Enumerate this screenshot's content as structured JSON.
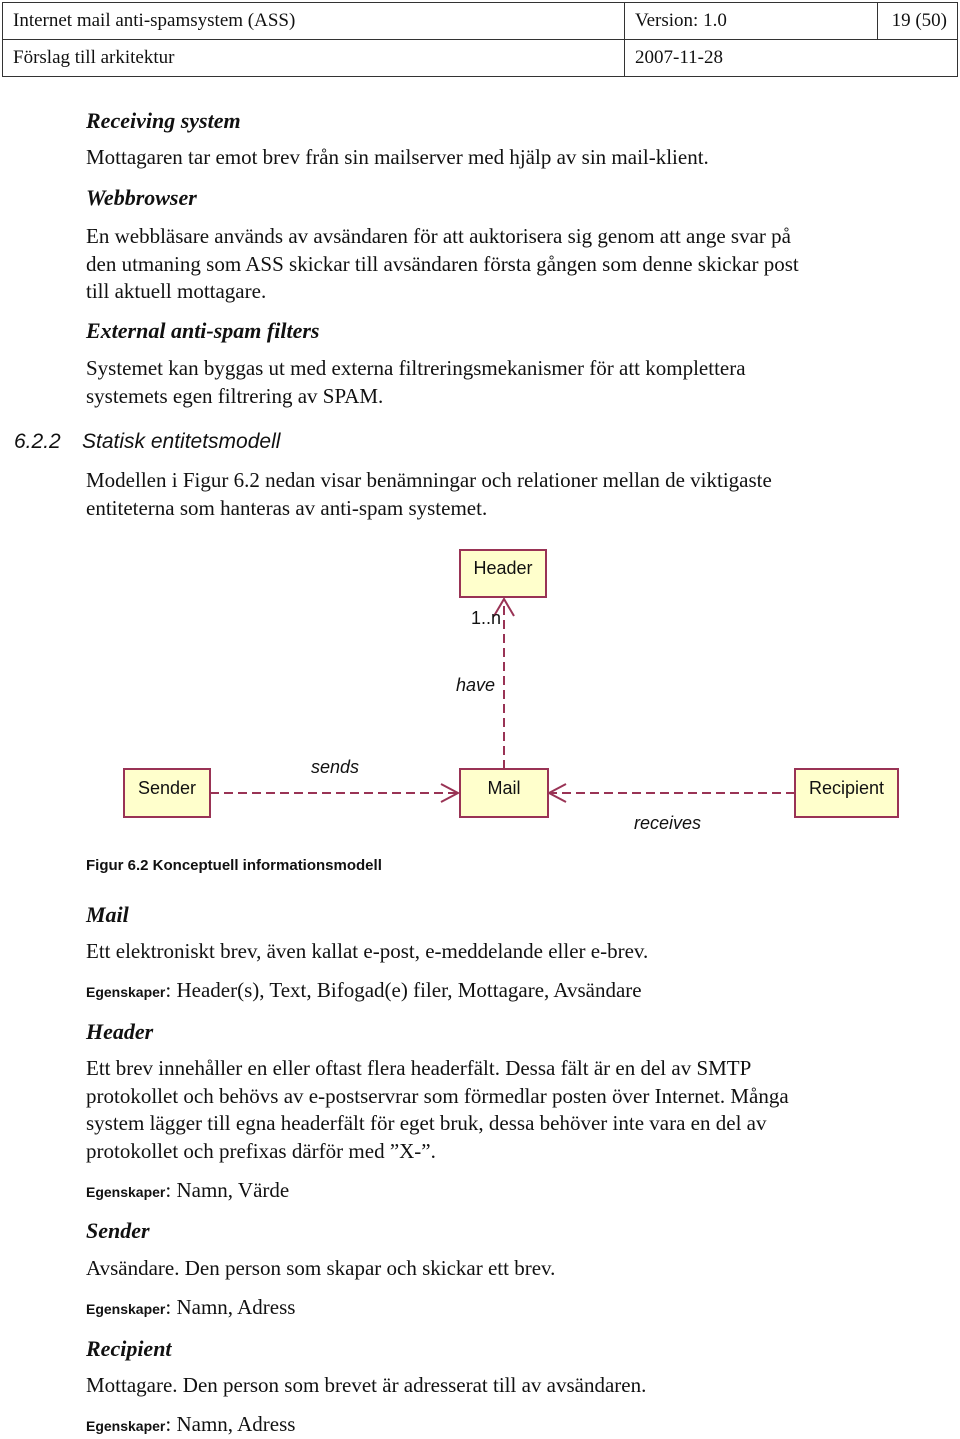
{
  "header": {
    "doc_title": "Internet mail anti-spamsystem (ASS)",
    "version": "Version: 1.0",
    "page": "19 (50)",
    "subtitle": "Förslag till arkitektur",
    "date": "2007-11-28"
  },
  "sections": {
    "receiving": {
      "title": "Receiving system",
      "text": "Mottagaren tar emot brev från sin mailserver med hjälp av sin mail-klient."
    },
    "webbrowser": {
      "title": "Webbrowser",
      "lines": [
        "En webbläsare används av avsändaren för att auktorisera sig genom att ange svar på",
        "den utmaning som ASS skickar till avsändaren första gången som denne skickar post",
        "till aktuell mottagare."
      ]
    },
    "external": {
      "title": "External anti-spam filters",
      "lines": [
        "Systemet kan byggas ut med externa filtreringsmekanismer för att komplettera",
        "systemets egen filtrering av SPAM."
      ]
    },
    "model": {
      "number": "6.2.2",
      "title": "Statisk entitetsmodell",
      "lines": [
        "Modellen i Figur 6.2 nedan visar benämningar och relationer mellan de viktigaste",
        "entiteterna som  hanteras av anti-spam systemet."
      ]
    }
  },
  "diagram": {
    "entities": {
      "header": "Header",
      "sender": "Sender",
      "mail": "Mail",
      "recipient": "Recipient"
    },
    "relations": {
      "have": "have",
      "multiplicity": "1..n",
      "sends": "sends",
      "receives": "receives"
    },
    "colors": {
      "fill": "#ffffcc",
      "stroke": "#993355"
    },
    "caption": "Figur 6.2 Konceptuell informationsmodell"
  },
  "definitions": {
    "label": "Egenskaper",
    "mail": {
      "title": "Mail",
      "lines": [
        "Ett elektroniskt brev, även kallat e-post, e-meddelande eller e-brev."
      ],
      "props": ": Header(s), Text, Bifogad(e) filer, Mottagare, Avsändare"
    },
    "header": {
      "title": "Header",
      "lines": [
        "Ett brev innehåller en eller oftast flera headerfält. Dessa fält är en del av SMTP",
        "protokollet och behövs av e-postservrar som förmedlar posten över Internet. Många",
        "system lägger till egna headerfält för eget bruk, dessa behöver inte vara en del av",
        "protokollet och prefixas därför med ”X-”."
      ],
      "props": ": Namn, Värde"
    },
    "sender": {
      "title": "Sender",
      "lines": [
        "Avsändare. Den person som skapar och skickar ett brev."
      ],
      "props": ": Namn, Adress"
    },
    "recipient": {
      "title": "Recipient",
      "lines": [
        "Mottagare. Den person som brevet är adresserat till av avsändaren."
      ],
      "props": ": Namn, Adress"
    }
  }
}
